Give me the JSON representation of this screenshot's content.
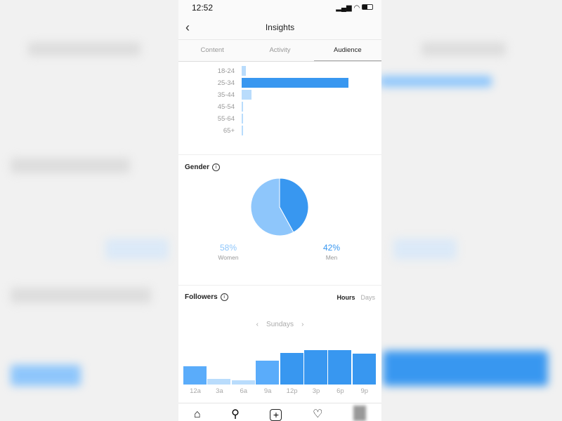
{
  "status_bar": {
    "time": "12:52"
  },
  "header": {
    "title": "Insights",
    "back_icon": "chevron-left-icon"
  },
  "tabs": [
    {
      "label": "Content"
    },
    {
      "label": "Activity"
    },
    {
      "label": "Audience",
      "active": true
    }
  ],
  "age_range": {
    "categories": [
      "18-24",
      "25-34",
      "35-44",
      "45-54",
      "55-64",
      "65+"
    ],
    "relative_values": [
      4,
      100,
      9,
      1,
      1,
      1
    ]
  },
  "gender": {
    "title": "Gender",
    "women": {
      "percent": "58%",
      "label": "Women",
      "color": "#8ec6fb"
    },
    "men": {
      "percent": "42%",
      "label": "Men",
      "color": "#3897f0"
    }
  },
  "followers": {
    "title": "Followers",
    "toggle": {
      "hours": "Hours",
      "days": "Days",
      "selected": "Hours"
    },
    "day": "Sundays",
    "hours": [
      "12a",
      "3a",
      "6a",
      "9a",
      "12p",
      "3p",
      "6p",
      "9p"
    ],
    "relative_values": [
      53,
      16,
      12,
      69,
      92,
      100,
      100,
      90
    ]
  },
  "colors": {
    "dark": "#3897f0",
    "mid": "#5aacfa",
    "light": "#b9dcfc"
  }
}
